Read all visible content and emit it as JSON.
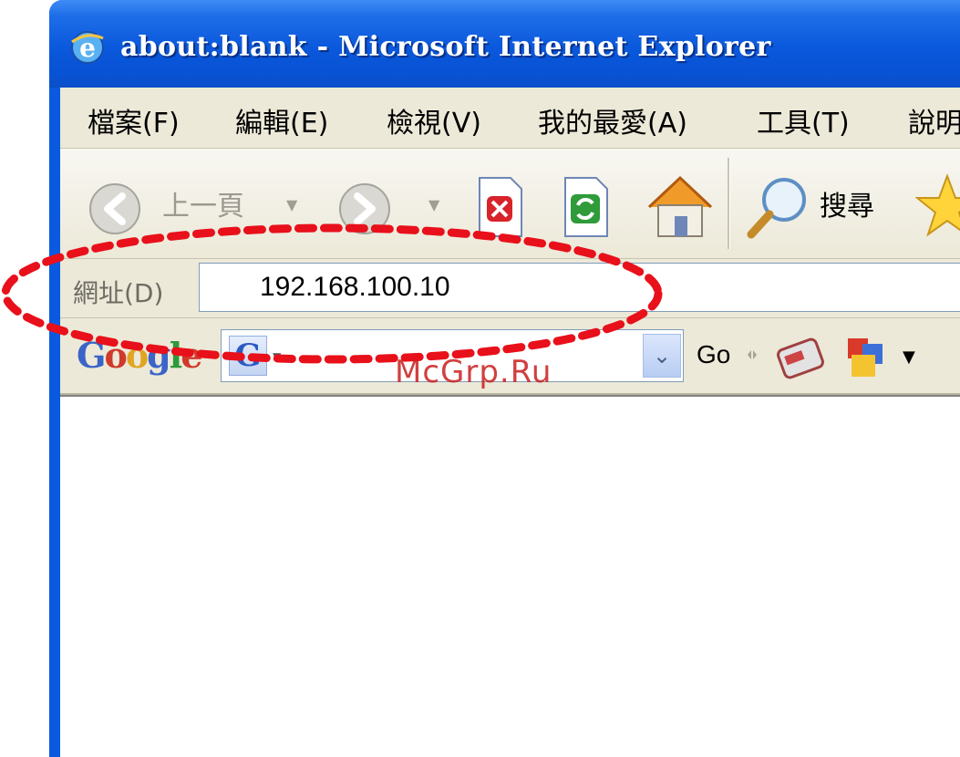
{
  "window": {
    "title": "about:blank - Microsoft Internet Explorer"
  },
  "menu": {
    "items": [
      "檔案(F)",
      "編輯(E)",
      "檢視(V)",
      "我的最愛(A)",
      "工具(T)",
      "說明"
    ]
  },
  "toolbar": {
    "back_label": "上一頁",
    "search_label": "搜尋",
    "icons": [
      "back-arrow-icon",
      "forward-arrow-icon",
      "stop-icon",
      "refresh-icon",
      "home-icon",
      "search-icon",
      "favorites-star-icon"
    ]
  },
  "address": {
    "label": "網址(D)",
    "value": "192.168.100.10"
  },
  "google_toolbar": {
    "logo": "Google",
    "go_label": "Go"
  },
  "colors": {
    "titlebar": "#0a58dc",
    "chrome": "#ece9d8",
    "highlight": "#e8101a",
    "watermark": "#c81e1e"
  },
  "watermark": "McGrp.Ru"
}
